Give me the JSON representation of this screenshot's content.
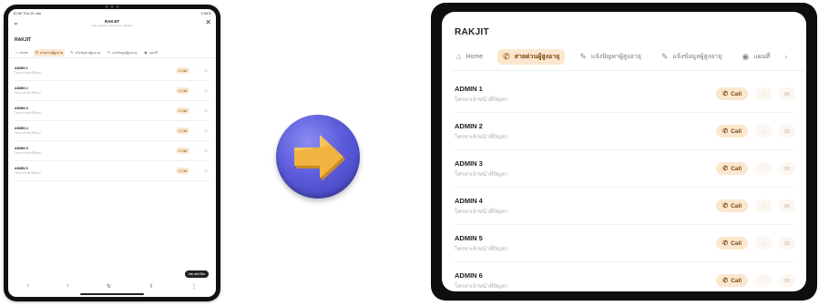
{
  "device_status": {
    "time": "10:36 Thu 29 Jan",
    "battery": "9 84%"
  },
  "sheet": {
    "title": "RAKJIT",
    "subtitle": "Ask a question about the software"
  },
  "app": {
    "title": "RAKJIT"
  },
  "tabs": [
    {
      "label": "Home",
      "icon": "home-icon",
      "active": false
    },
    {
      "label": "สายด่วนผู้สูงอายุ",
      "icon": "phone-icon",
      "active": true
    },
    {
      "label": "แจ้งปัญหาผู้สูงอายุ",
      "icon": "pencil-icon",
      "active": false
    },
    {
      "label": "แจ้งข้อมูลผู้สูงอายุ",
      "icon": "pencil-icon",
      "active": false
    },
    {
      "label": "แผนที่",
      "icon": "eye-icon",
      "active": false
    }
  ],
  "contacts": [
    {
      "name": "ADMIN 1",
      "subtitle": "โทรหาเจ้าหน้าที่ปัญหา",
      "call_label": "Call"
    },
    {
      "name": "ADMIN 2",
      "subtitle": "โทรหาเจ้าหน้าที่ปัญหา",
      "call_label": "Call"
    },
    {
      "name": "ADMIN 3",
      "subtitle": "โทรหาเจ้าหน้าที่ปัญหา",
      "call_label": "Call"
    },
    {
      "name": "ADMIN 4",
      "subtitle": "โทรหาเจ้าหน้าที่ปัญหา",
      "call_label": "Call"
    },
    {
      "name": "ADMIN 5",
      "subtitle": "โทรหาเจ้าหน้าที่ปัญหา",
      "call_label": "Call"
    },
    {
      "name": "ADMIN 6",
      "subtitle": "โทรหาเจ้าหน้าที่ปัญหา",
      "call_label": "Call"
    }
  ],
  "ask_button": "Ask with Bito",
  "icons": {
    "call": "phone-icon",
    "chat": "chat-bubble-icon",
    "mail": "mail-icon"
  },
  "colors": {
    "accent_bg": "#fbe7cf",
    "accent_text": "#7a4a12",
    "arrow_circle": "#5c5cdc",
    "arrow": "#f2b441"
  }
}
